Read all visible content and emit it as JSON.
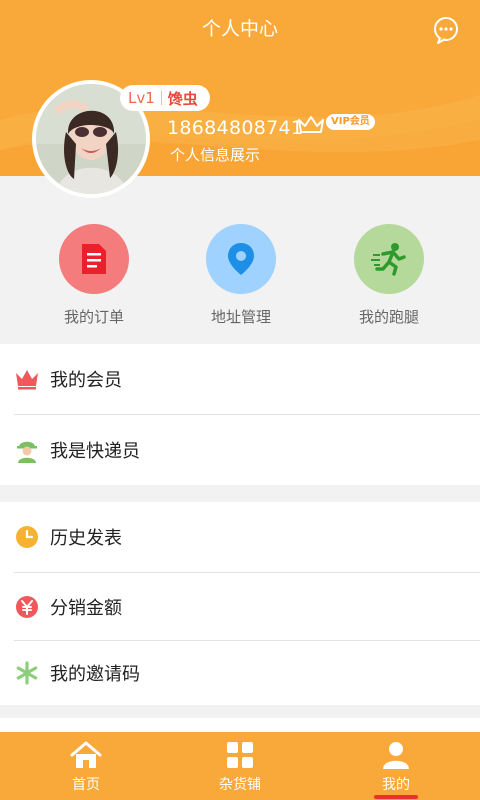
{
  "header": {
    "title": "个人中心",
    "chat_icon": "chat-bubble-icon",
    "bg_color": "#f9a93a"
  },
  "profile": {
    "level": "Lv1",
    "nickname": "馋虫",
    "phone": "18684808741",
    "vip_badge": "VIP会员",
    "info_label": "个人信息展示",
    "avatar_icon": "user-avatar-photo"
  },
  "quick_menu": [
    {
      "label": "我的订单",
      "icon": "order-document-icon",
      "color": "#f47c7c"
    },
    {
      "label": "地址管理",
      "icon": "location-pin-icon",
      "color": "#9fd2ff"
    },
    {
      "label": "我的跑腿",
      "icon": "runner-icon",
      "color": "#b5d99a"
    }
  ],
  "group1": [
    {
      "label": "我的会员",
      "icon": "crown-icon"
    },
    {
      "label": "我是快递员",
      "icon": "courier-icon"
    }
  ],
  "group2": [
    {
      "label": "历史发表",
      "icon": "clock-icon"
    },
    {
      "label": "分销金额",
      "icon": "yuan-icon"
    },
    {
      "label": "我的邀请码",
      "icon": "asterisk-icon"
    }
  ],
  "tabbar": [
    {
      "label": "首页",
      "icon": "home-icon"
    },
    {
      "label": "杂货铺",
      "icon": "grid-icon"
    },
    {
      "label": "我的",
      "icon": "person-icon",
      "active": true
    }
  ],
  "colors": {
    "accent": "#f9a93a",
    "active_indicator": "#e8332a"
  }
}
